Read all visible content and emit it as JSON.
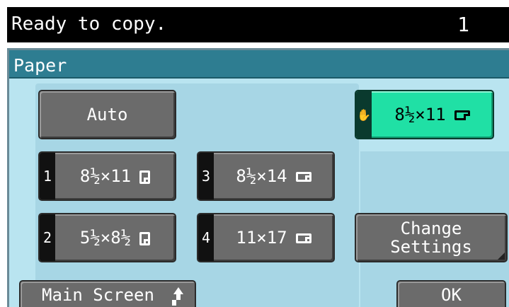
{
  "status": {
    "message": "Ready to copy.",
    "count": "1"
  },
  "panel": {
    "title": "Paper"
  },
  "buttons": {
    "auto": "Auto",
    "selected": {
      "label": "8½×11",
      "orientation": "landscape",
      "icon": "hand-icon"
    },
    "trays": [
      {
        "num": "1",
        "label": "8½×11",
        "orientation": "portrait"
      },
      {
        "num": "3",
        "label": "8½×14",
        "orientation": "landscape"
      },
      {
        "num": "2",
        "label": "5½×8½",
        "orientation": "portrait"
      },
      {
        "num": "4",
        "label": "11×17",
        "orientation": "landscape"
      }
    ],
    "change_settings_line1": "Change",
    "change_settings_line2": "Settings"
  },
  "bottom": {
    "main_screen": "Main Screen",
    "ok": "OK"
  },
  "colors": {
    "status_bg": "#000000",
    "header_bg": "#2e7d91",
    "panel_bg": "#b9e4f0",
    "selected": "#20e0a5",
    "button": "#6b6b6b"
  }
}
